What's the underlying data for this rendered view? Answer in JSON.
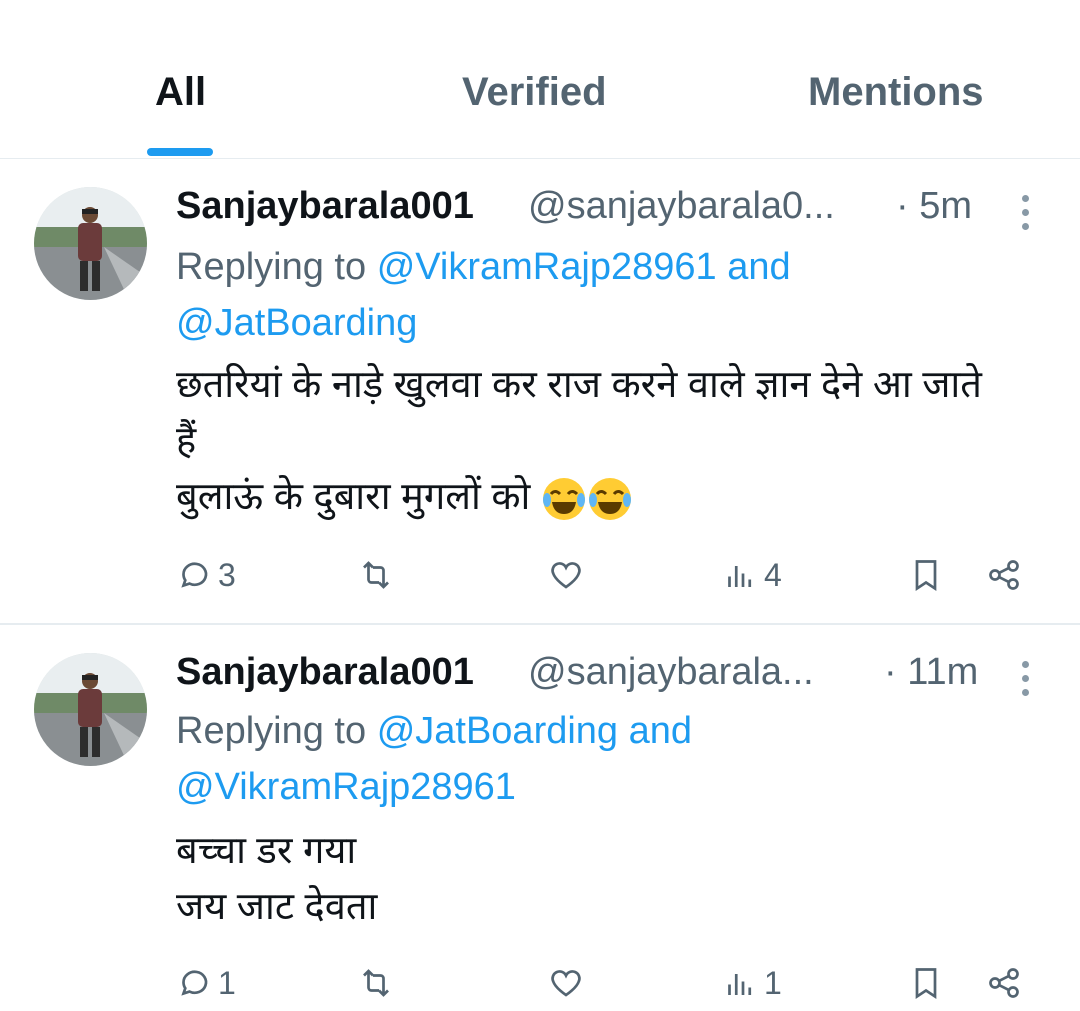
{
  "tabs": {
    "all": "All",
    "verified": "Verified",
    "mentions": "Mentions"
  },
  "tweets": [
    {
      "display_name": "Sanjaybarala001",
      "handle": "@sanjaybarala0...",
      "time": "· 5m",
      "replying_prefix": "Replying to",
      "reply_user_1": "@VikramRajp28961",
      "reply_and": "and",
      "reply_user_2": "@JatBoarding",
      "body_line_1": "छतरियां के नाड़े खुलवा कर राज करने वाले ज्ञान देने आ जाते",
      "body_line_2": "हैं",
      "body_line_3": "बुलाऊं के दुबारा मुगलों को",
      "emoji": "face-with-tears-of-joy",
      "replies": "3",
      "retweets": "",
      "likes": "",
      "views": "4"
    },
    {
      "display_name": "Sanjaybarala001",
      "handle": "@sanjaybarala...",
      "time": "· 11m",
      "replying_prefix": "Replying to",
      "reply_user_1": "@JatBoarding",
      "reply_and": "and",
      "reply_user_2": "@VikramRajp28961",
      "body_line_1": "बच्चा डर गया",
      "body_line_2": "जय जाट देवता",
      "replies": "1",
      "retweets": "",
      "likes": "",
      "views": "1"
    }
  ],
  "colors": {
    "accent": "#1d9bf0",
    "secondary_text": "#536471",
    "divider": "#e6ecf0"
  }
}
